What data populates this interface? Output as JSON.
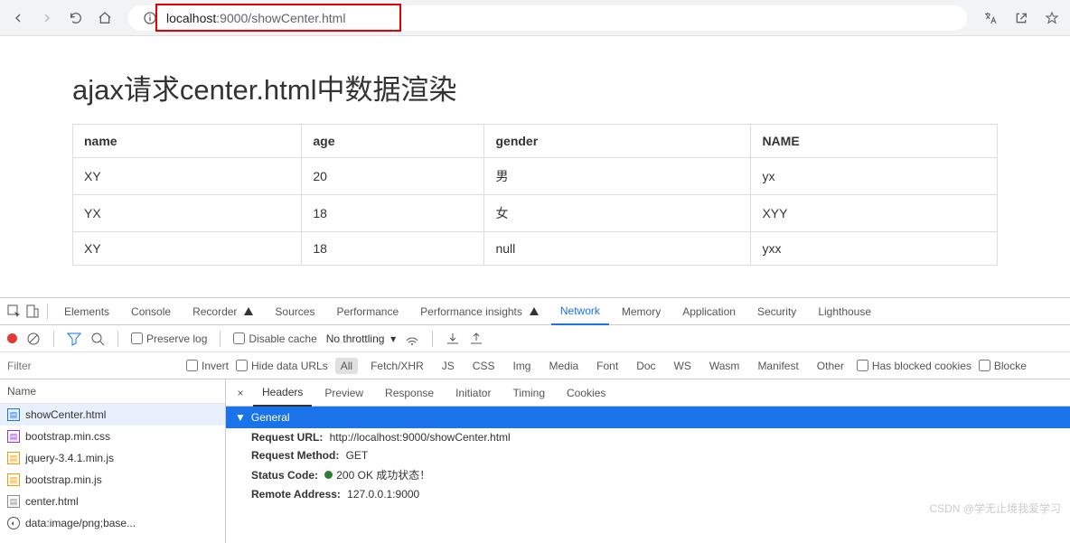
{
  "browser": {
    "url_display_prefix": "localhost",
    "url_display_suffix": ":9000/showCenter.html"
  },
  "page": {
    "title": "ajax请求center.html中数据渲染",
    "headers": [
      "name",
      "age",
      "gender",
      "NAME"
    ],
    "rows": [
      {
        "c0": "XY",
        "c1": "20",
        "c2": "男",
        "c3": "yx"
      },
      {
        "c0": "YX",
        "c1": "18",
        "c2": "女",
        "c3": "XYY"
      },
      {
        "c0": "XY",
        "c1": "18",
        "c2": "null",
        "c3": "yxx"
      }
    ]
  },
  "devtools": {
    "tabs": {
      "elements": "Elements",
      "console": "Console",
      "recorder": "Recorder",
      "sources": "Sources",
      "performance": "Performance",
      "perfinsights": "Performance insights",
      "network": "Network",
      "memory": "Memory",
      "application": "Application",
      "security": "Security",
      "lighthouse": "Lighthouse"
    },
    "toolbar": {
      "preserve": "Preserve log",
      "disable": "Disable cache",
      "throttle": "No throttling"
    },
    "filterbar": {
      "filter_ph": "Filter",
      "invert": "Invert",
      "hide": "Hide data URLs",
      "all": "All",
      "fetch": "Fetch/XHR",
      "js": "JS",
      "css": "CSS",
      "img": "Img",
      "media": "Media",
      "font": "Font",
      "doc": "Doc",
      "ws": "WS",
      "wasm": "Wasm",
      "manifest": "Manifest",
      "other": "Other",
      "blocked_cookies": "Has blocked cookies",
      "blocked_req": "Blocke"
    },
    "requests": {
      "name_col": "Name",
      "items": [
        {
          "name": "showCenter.html",
          "icon": "doc",
          "color": "#1a73e8"
        },
        {
          "name": "bootstrap.min.css",
          "icon": "css",
          "color": "#9334e6"
        },
        {
          "name": "jquery-3.4.1.min.js",
          "icon": "js",
          "color": "#f29900"
        },
        {
          "name": "bootstrap.min.js",
          "icon": "js",
          "color": "#f29900"
        },
        {
          "name": "center.html",
          "icon": "doc",
          "color": "#888"
        },
        {
          "name": "data:image/png;base...",
          "icon": "img",
          "color": "#555"
        }
      ]
    },
    "detail": {
      "tabs": {
        "headers": "Headers",
        "preview": "Preview",
        "response": "Response",
        "initiator": "Initiator",
        "timing": "Timing",
        "cookies": "Cookies"
      },
      "general_label": "General",
      "request_url_label": "Request URL:",
      "request_url": "http://localhost:9000/showCenter.html",
      "request_method_label": "Request Method:",
      "request_method": "GET",
      "status_label": "Status Code:",
      "status_value": "200 OK 成功状态！",
      "remote_label": "Remote Address:",
      "remote_value": "127.0.0.1:9000"
    }
  },
  "watermark": "CSDN @学无止境我爱学习"
}
